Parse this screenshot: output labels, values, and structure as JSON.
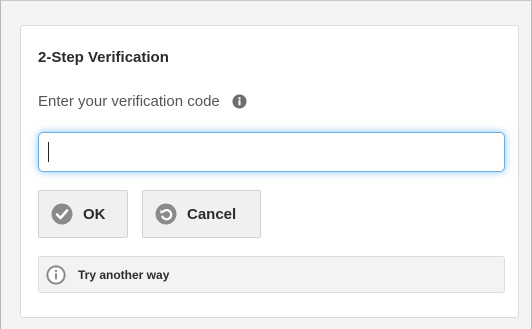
{
  "dialog": {
    "title": "2-Step Verification",
    "prompt": "Enter your verification code",
    "code_input": {
      "value": "",
      "placeholder": ""
    },
    "ok_label": "OK",
    "cancel_label": "Cancel",
    "try_another_label": "Try another way"
  },
  "icons": {
    "prompt_info": "info-icon",
    "ok": "check-circle-icon",
    "cancel": "undo-circle-icon",
    "try_another": "info-circle-icon"
  },
  "colors": {
    "input_focus": "#66afe9",
    "icon_gray": "#888888",
    "button_bg": "#f0f0f0"
  }
}
